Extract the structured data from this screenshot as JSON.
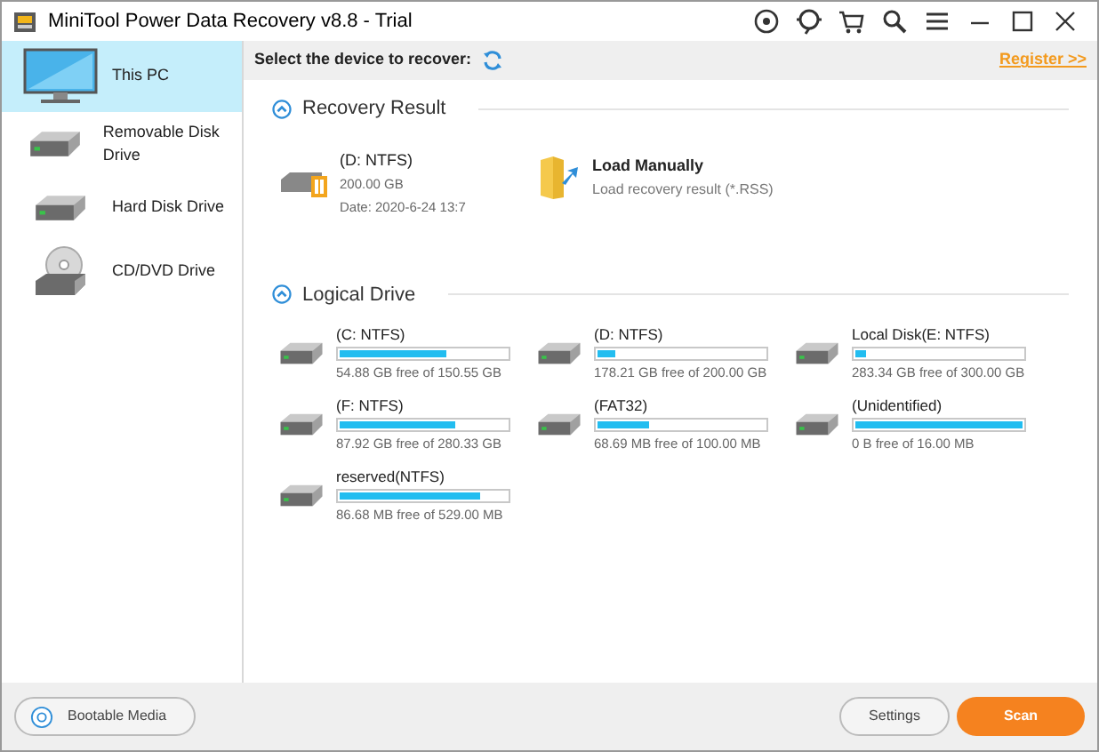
{
  "window": {
    "title": "MiniTool Power Data Recovery v8.8 - Trial"
  },
  "sidebar": {
    "items": [
      {
        "label": "This PC",
        "kind": "pc",
        "selected": true
      },
      {
        "label": "Removable Disk Drive",
        "kind": "drive",
        "selected": false
      },
      {
        "label": "Hard Disk Drive",
        "kind": "drive",
        "selected": false
      },
      {
        "label": "CD/DVD Drive",
        "kind": "cd",
        "selected": false
      }
    ]
  },
  "header": {
    "prompt": "Select the device to recover:",
    "register_link": "Register >>"
  },
  "recovery_result": {
    "title": "Recovery Result",
    "item": {
      "name": "(D: NTFS)",
      "size": "200.00 GB",
      "date": "Date: 2020-6-24 13:7"
    },
    "load": {
      "title": "Load Manually",
      "subtitle": "Load recovery result (*.RSS)"
    }
  },
  "logical_drive": {
    "title": "Logical Drive",
    "drives": [
      {
        "name": "(C: NTFS)",
        "level": 0.64,
        "free": "54.88 GB free of 150.55 GB"
      },
      {
        "name": "(D: NTFS)",
        "level": 0.11,
        "free": "178.21 GB free of 200.00 GB"
      },
      {
        "name": "Local Disk(E: NTFS)",
        "level": 0.06,
        "free": "283.34 GB free of 300.00 GB"
      },
      {
        "name": "(F: NTFS)",
        "level": 0.69,
        "free": "87.92 GB free of 280.33 GB"
      },
      {
        "name": "(FAT32)",
        "level": 0.31,
        "free": "68.69 MB free of 100.00 MB"
      },
      {
        "name": "(Unidentified)",
        "level": 1.0,
        "free": "0 B free of 16.00 MB"
      },
      {
        "name": "reserved(NTFS)",
        "level": 0.84,
        "free": "86.68 MB free of 529.00 MB"
      }
    ]
  },
  "footer": {
    "bootable": "Bootable Media",
    "settings": "Settings",
    "scan": "Scan"
  }
}
